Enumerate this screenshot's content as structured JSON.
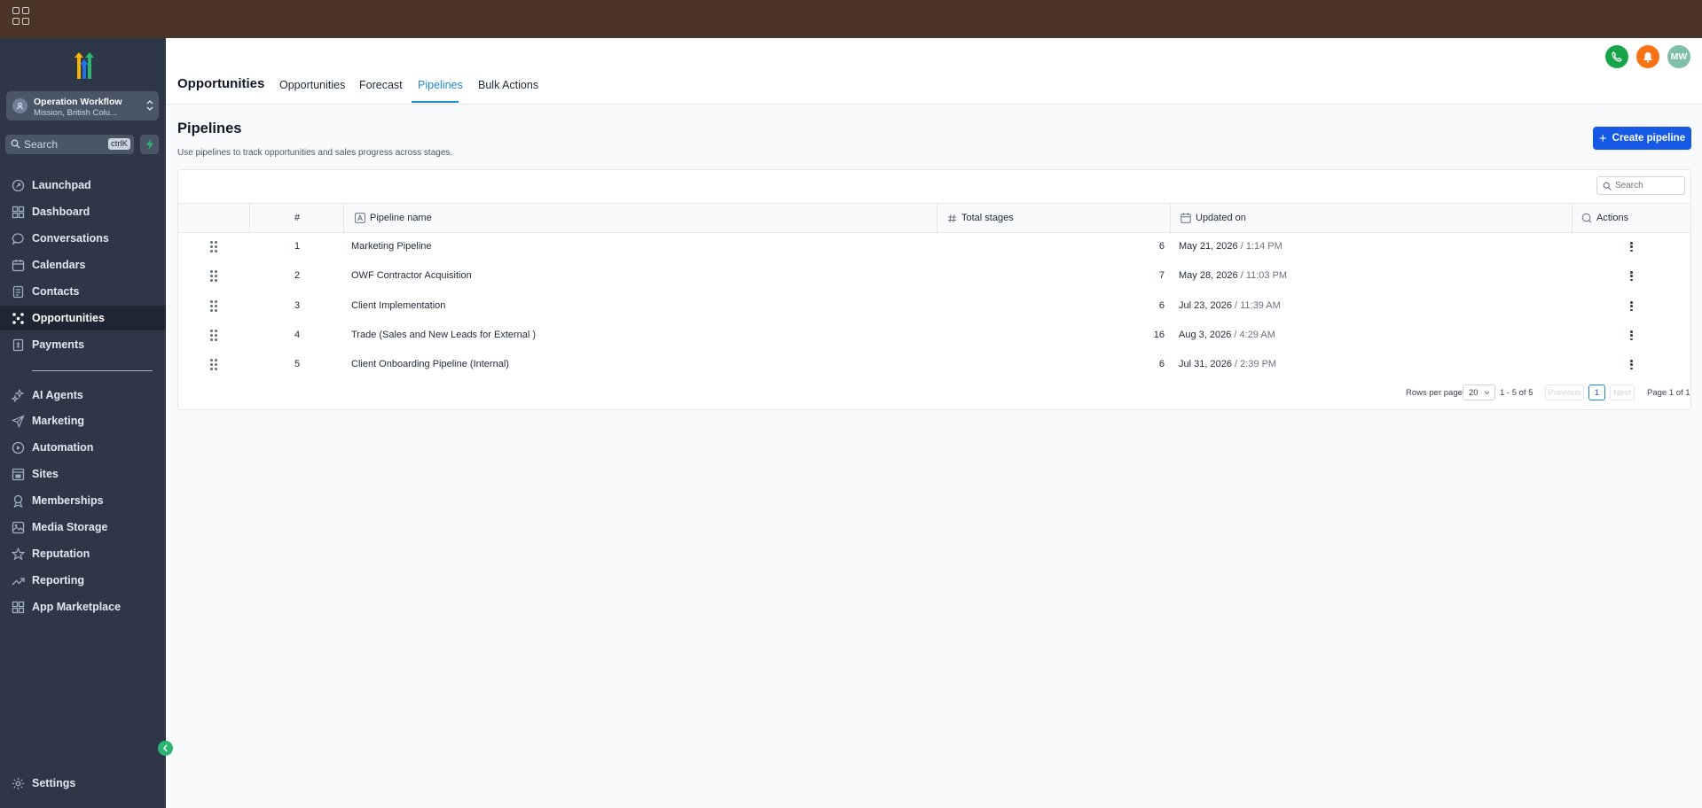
{
  "sidebar": {
    "account": {
      "name": "Operation Workflow",
      "location": "Mission, British Colu..."
    },
    "search": {
      "placeholder": "Search",
      "shortcut": "ctrlK"
    },
    "items": [
      {
        "label": "Launchpad",
        "icon": "rocket-icon"
      },
      {
        "label": "Dashboard",
        "icon": "dashboard-icon"
      },
      {
        "label": "Conversations",
        "icon": "chat-icon"
      },
      {
        "label": "Calendars",
        "icon": "calendar-icon"
      },
      {
        "label": "Contacts",
        "icon": "contacts-icon"
      },
      {
        "label": "Opportunities",
        "icon": "opportunities-icon",
        "active": true
      },
      {
        "label": "Payments",
        "icon": "payments-icon"
      },
      {
        "label": "AI Agents",
        "icon": "sparkle-icon"
      },
      {
        "label": "Marketing",
        "icon": "send-icon"
      },
      {
        "label": "Automation",
        "icon": "automation-icon"
      },
      {
        "label": "Sites",
        "icon": "sites-icon"
      },
      {
        "label": "Memberships",
        "icon": "award-icon"
      },
      {
        "label": "Media Storage",
        "icon": "image-icon"
      },
      {
        "label": "Reputation",
        "icon": "star-icon"
      },
      {
        "label": "Reporting",
        "icon": "trend-icon"
      },
      {
        "label": "App Marketplace",
        "icon": "grid-icon"
      },
      {
        "label": "Settings",
        "icon": "gear-icon"
      }
    ]
  },
  "header": {
    "title": "Opportunities",
    "tabs": [
      "Opportunities",
      "Forecast",
      "Pipelines",
      "Bulk Actions"
    ],
    "active_tab": "Pipelines",
    "avatar_initials": "MW"
  },
  "page": {
    "title": "Pipelines",
    "description": "Use pipelines to track opportunities and sales progress across stages.",
    "create_button": "Create pipeline"
  },
  "table": {
    "search_placeholder": "Search",
    "columns": {
      "num": "#",
      "name": "Pipeline name",
      "stages": "Total stages",
      "updated": "Updated on",
      "actions": "Actions"
    },
    "rows": [
      {
        "num": "1",
        "name": "Marketing Pipeline",
        "stages": "6",
        "date": "May 21, 2026",
        "time": "1:14 PM"
      },
      {
        "num": "2",
        "name": "OWF Contractor Acquisition",
        "stages": "7",
        "date": "May 28, 2026",
        "time": "11:03 PM"
      },
      {
        "num": "3",
        "name": "Client Implementation",
        "stages": "6",
        "date": "Jul 23, 2026",
        "time": "11:39 AM"
      },
      {
        "num": "4",
        "name": "Trade (Sales and New Leads for External )",
        "stages": "16",
        "date": "Aug 3, 2026",
        "time": "4:29 AM"
      },
      {
        "num": "5",
        "name": "Client Onboarding Pipeline (Internal)",
        "stages": "6",
        "date": "Jul 31, 2026",
        "time": "2:39 PM"
      }
    ]
  },
  "pagination": {
    "rows_per_page_label": "Rows per page",
    "rows_per_page": "20",
    "range": "1 - 5 of 5",
    "previous": "Previous",
    "current_page": "1",
    "next": "Next",
    "page_of": "Page 1 of 1"
  },
  "colors": {
    "accent": "#1d8ad8",
    "primary_button": "#1559e6",
    "sidebar": "#2d3748",
    "topbar": "#4a3426"
  }
}
